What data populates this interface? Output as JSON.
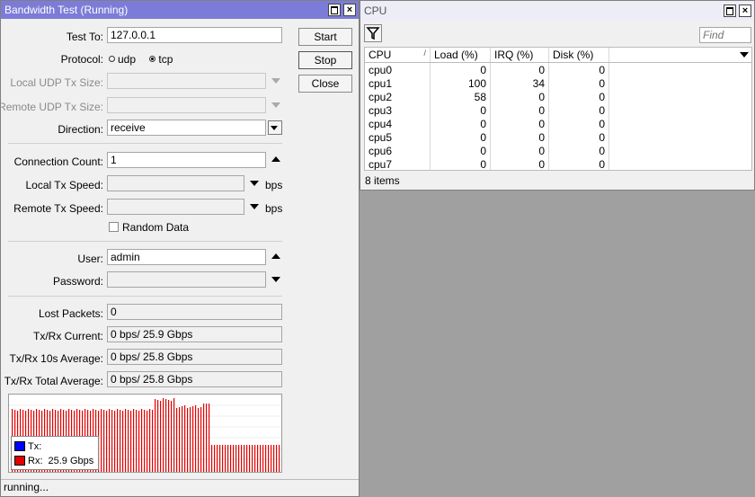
{
  "bandwidth": {
    "title": "Bandwidth Test (Running)",
    "fields": {
      "test_to": {
        "label": "Test To:",
        "value": "127.0.0.1"
      },
      "protocol": {
        "label": "Protocol:",
        "options": [
          "udp",
          "tcp"
        ],
        "selected": "tcp"
      },
      "local_udp_tx_size": {
        "label": "Local UDP Tx Size:",
        "value": ""
      },
      "remote_udp_tx_size": {
        "label": "Remote UDP Tx Size:",
        "value": ""
      },
      "direction": {
        "label": "Direction:",
        "value": "receive"
      },
      "connection_count": {
        "label": "Connection Count:",
        "value": "1"
      },
      "local_tx_speed": {
        "label": "Local Tx Speed:",
        "value": "",
        "unit": "bps"
      },
      "remote_tx_speed": {
        "label": "Remote Tx Speed:",
        "value": "",
        "unit": "bps"
      },
      "random_data": {
        "label": "Random Data",
        "checked": false
      },
      "user": {
        "label": "User:",
        "value": "admin"
      },
      "password": {
        "label": "Password:",
        "value": ""
      },
      "lost_packets": {
        "label": "Lost Packets:",
        "value": "0"
      },
      "current": {
        "label": "Tx/Rx Current:",
        "value": "0 bps/ 25.9 Gbps"
      },
      "avg10s": {
        "label": "Tx/Rx 10s Average:",
        "value": "0 bps/ 25.8 Gbps"
      },
      "total_avg": {
        "label": "Tx/Rx Total Average:",
        "value": "0 bps/ 25.8 Gbps"
      }
    },
    "buttons": {
      "start": "Start",
      "stop": "Stop",
      "close": "Close"
    },
    "legend": {
      "tx": "Tx:",
      "rx": "Rx:",
      "rx_value": "25.9 Gbps",
      "tx_color": "#0000ff",
      "rx_color": "#e00000"
    },
    "status": "running..."
  },
  "cpu": {
    "title": "CPU",
    "find_placeholder": "Find",
    "columns": [
      "CPU",
      "Load (%)",
      "IRQ (%)",
      "Disk (%)"
    ],
    "rows": [
      {
        "cpu": "cpu0",
        "load": "0",
        "irq": "0",
        "disk": "0"
      },
      {
        "cpu": "cpu1",
        "load": "100",
        "irq": "34",
        "disk": "0"
      },
      {
        "cpu": "cpu2",
        "load": "58",
        "irq": "0",
        "disk": "0"
      },
      {
        "cpu": "cpu3",
        "load": "0",
        "irq": "0",
        "disk": "0"
      },
      {
        "cpu": "cpu4",
        "load": "0",
        "irq": "0",
        "disk": "0"
      },
      {
        "cpu": "cpu5",
        "load": "0",
        "irq": "0",
        "disk": "0"
      },
      {
        "cpu": "cpu6",
        "load": "0",
        "irq": "0",
        "disk": "0"
      },
      {
        "cpu": "cpu7",
        "load": "0",
        "irq": "0",
        "disk": "0"
      }
    ],
    "item_count": "8 items"
  }
}
